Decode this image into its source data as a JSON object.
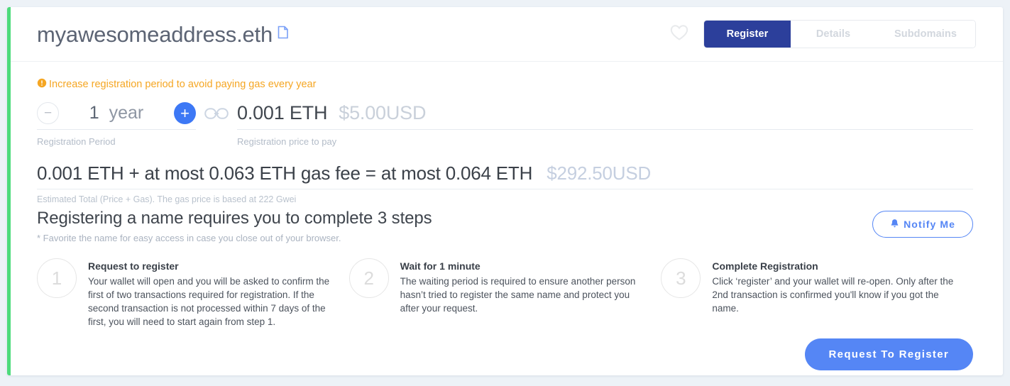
{
  "header": {
    "domain": "myawesomeaddress.eth",
    "copy_icon": "document-copy-icon",
    "favorite_icon": "heart-icon",
    "tabs": [
      {
        "label": "Register",
        "active": true
      },
      {
        "label": "Details",
        "active": false
      },
      {
        "label": "Subdomains",
        "active": false
      }
    ]
  },
  "warning": {
    "icon": "exclamation-circle-icon",
    "text": "Increase registration period to avoid paying gas every year",
    "color": "#f5a623"
  },
  "registration": {
    "decrement_label": "−",
    "increment_label": "+",
    "period_value": "1",
    "period_unit": "year",
    "period_caption": "Registration Period",
    "link_icon": "chain-link-icon",
    "price_eth": "0.001 ETH",
    "price_usd": "$5.00USD",
    "price_caption": "Registration price to pay"
  },
  "total": {
    "eth": "0.001 ETH + at most 0.063 ETH gas fee = at most 0.064 ETH",
    "usd": "$292.50USD",
    "caption": "Estimated Total (Price + Gas). The gas price is based at 222 Gwei"
  },
  "steps_section": {
    "heading": "Registering a name requires you to complete 3 steps",
    "subtext": "* Favorite the name for easy access in case you close out of your browser.",
    "notify_button": {
      "label": "Notify Me",
      "icon": "bell-icon"
    },
    "steps": [
      {
        "number": "1",
        "title": "Request to register",
        "description": "Your wallet will open and you will be asked to confirm the first of two transactions required for registration. If the second transaction is not processed within 7 days of the first, you will need to start again from step 1."
      },
      {
        "number": "2",
        "title": "Wait for 1 minute",
        "description": "The waiting period is required to ensure another person hasn’t tried to register the same name and protect you after your request."
      },
      {
        "number": "3",
        "title": "Complete Registration",
        "description": "Click ‘register’ and your wallet will re-open. Only after the 2nd transaction is confirmed you'll know if you got the name."
      }
    ]
  },
  "footer": {
    "request_button": "Request To Register"
  },
  "colors": {
    "accent_blue": "#5586f5",
    "tab_active_blue": "#2c3f9b",
    "plus_blue": "#3d78f5",
    "warning_orange": "#f5a623",
    "card_edge_green": "#4ddb7b",
    "page_background": "#edf2f7"
  }
}
